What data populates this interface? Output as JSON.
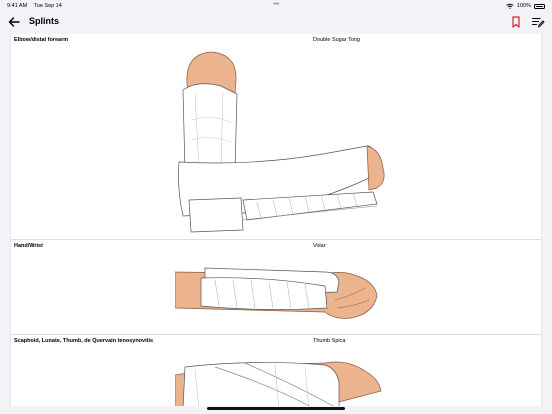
{
  "status": {
    "time": "9:41 AM",
    "date": "Tue Sep 14",
    "battery": "100%"
  },
  "nav": {
    "title": "Splints"
  },
  "splints": [
    {
      "region": "Elbow/distal forearm",
      "type": "Double Sugar Tong"
    },
    {
      "region": "Hand/Wrist",
      "type": "Volar"
    },
    {
      "region": "Scaphoid, Lunate, Thumb, de Quervain tenosynovitis",
      "type": "Thumb Spica"
    }
  ],
  "colors": {
    "accent": "#d7262e",
    "skin": "#ecb38f",
    "bandage": "#ffffff"
  }
}
